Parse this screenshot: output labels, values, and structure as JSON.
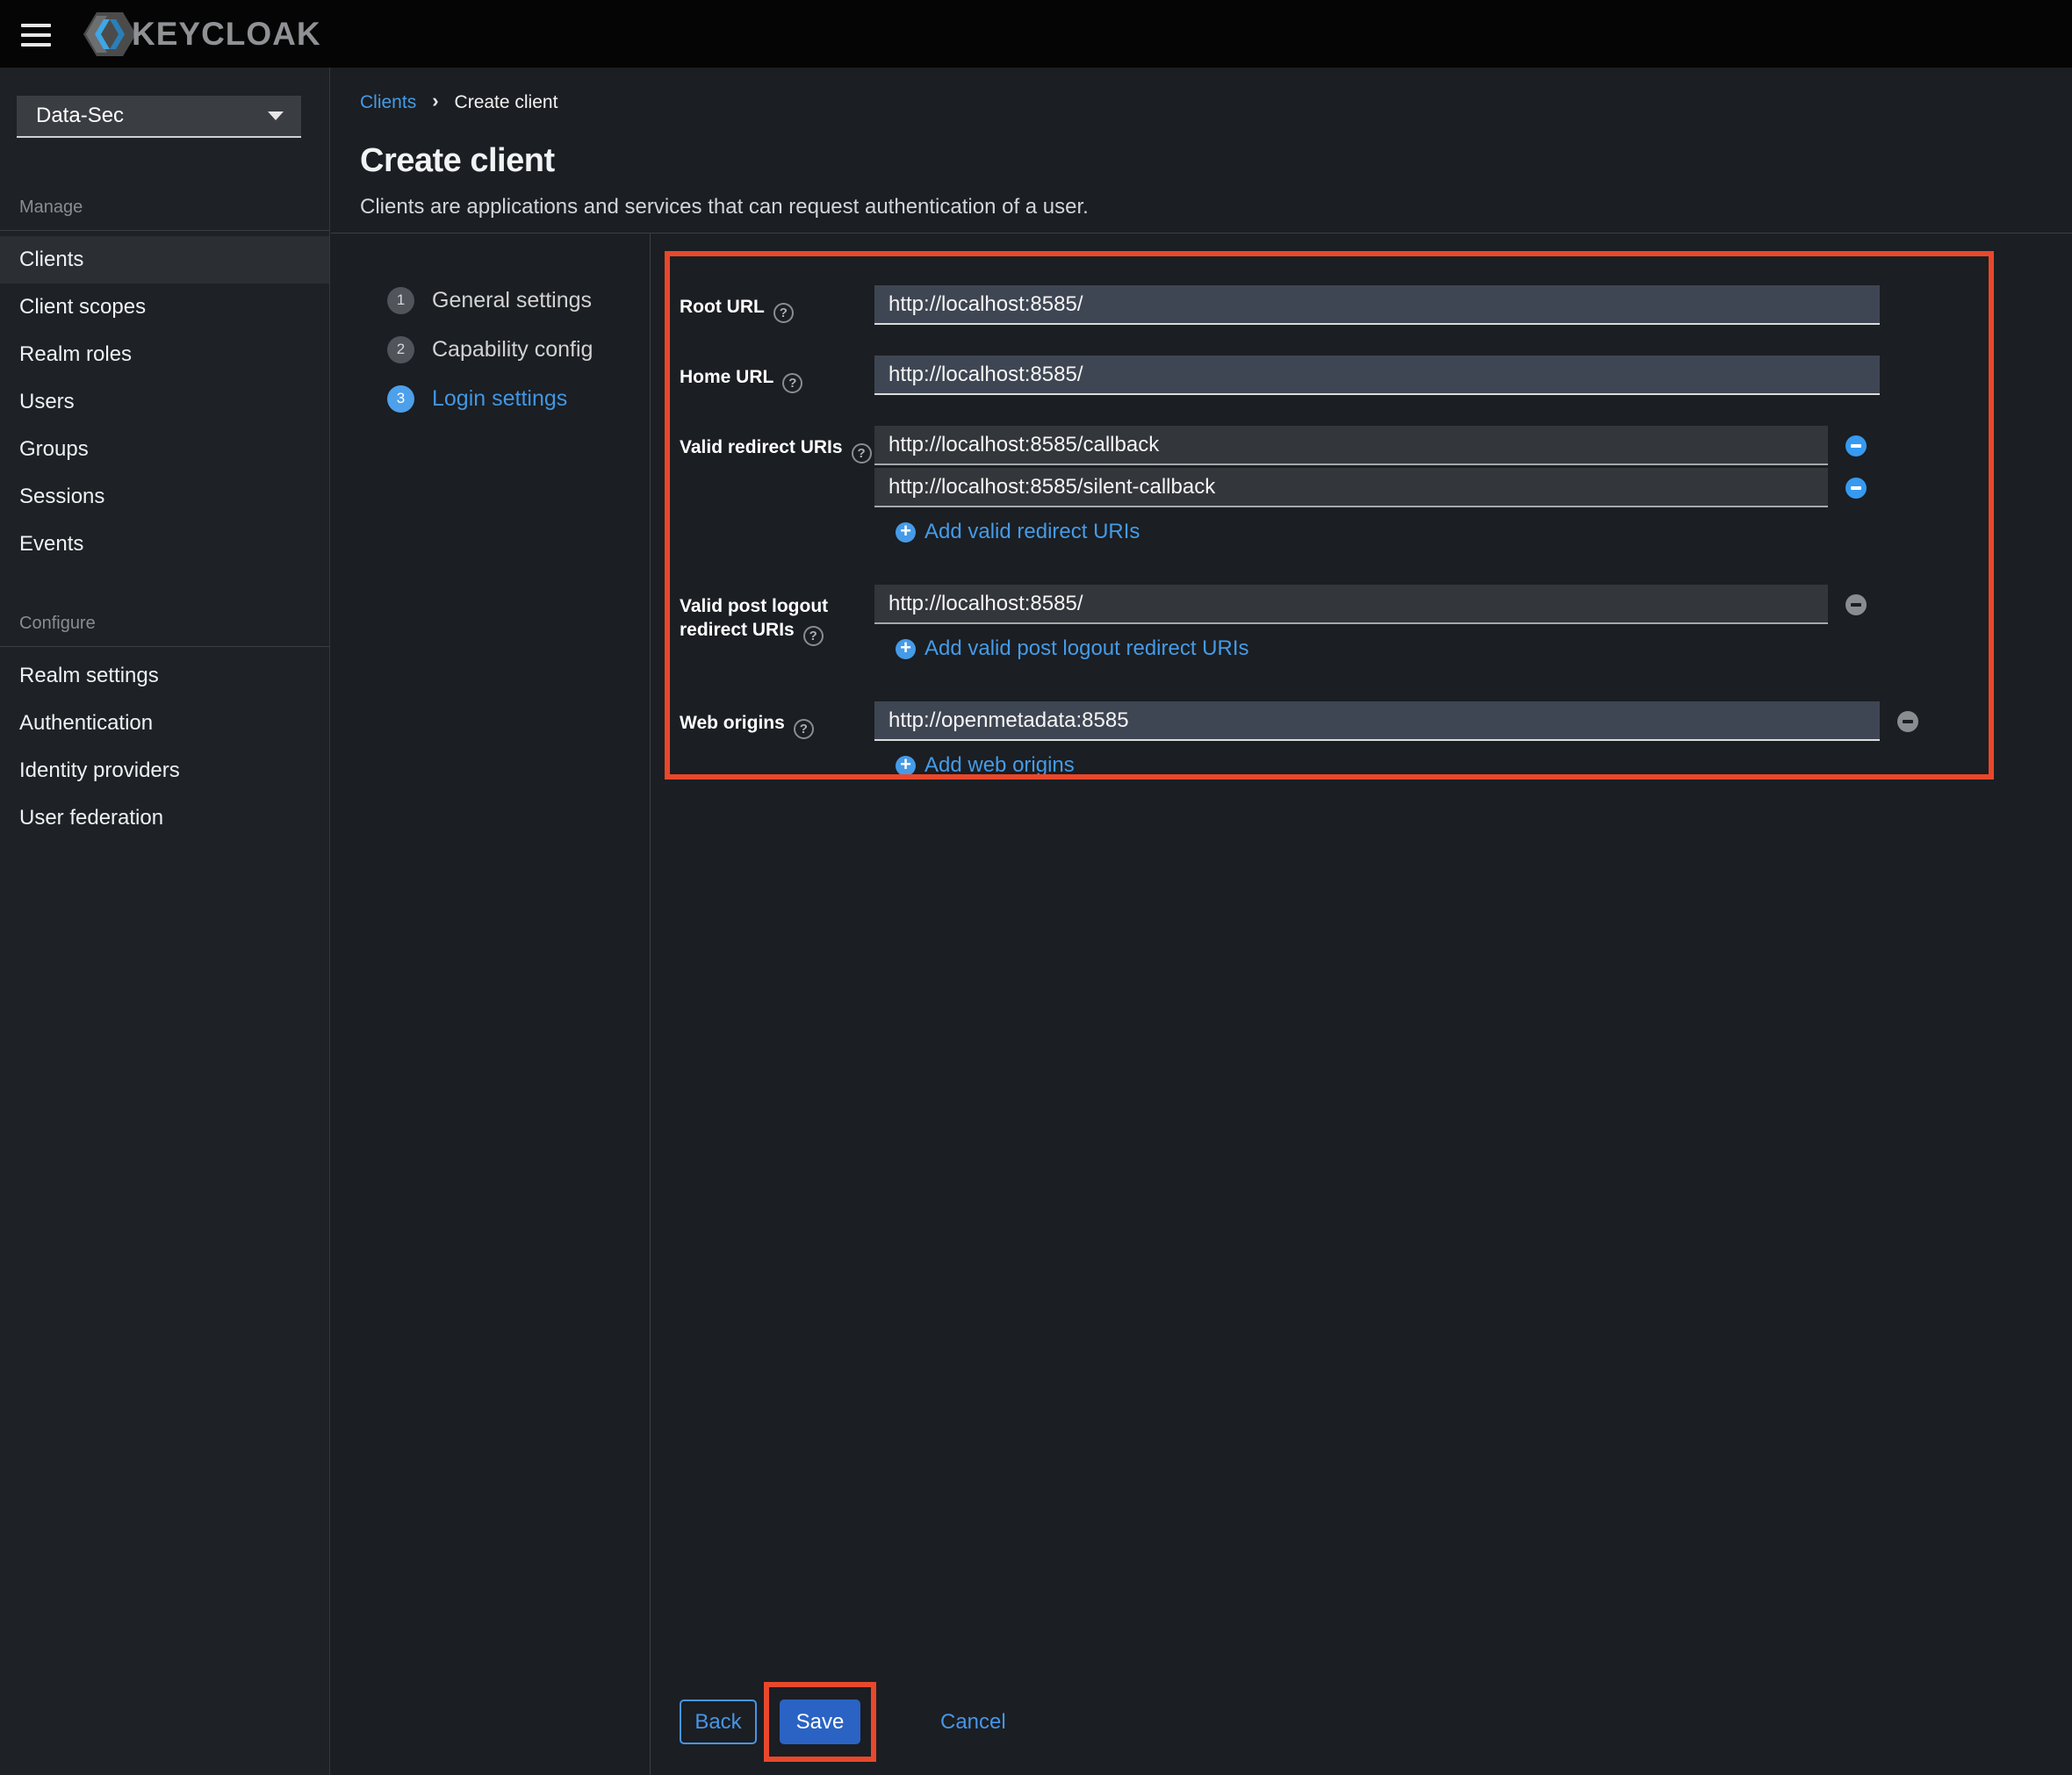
{
  "topbar": {
    "brand": "KEYCLOAK"
  },
  "sidebar": {
    "realm_selector": {
      "value": "Data-Sec"
    },
    "groups": [
      {
        "label": "Manage",
        "items": [
          {
            "label": "Clients",
            "active": true
          },
          {
            "label": "Client scopes"
          },
          {
            "label": "Realm roles"
          },
          {
            "label": "Users"
          },
          {
            "label": "Groups"
          },
          {
            "label": "Sessions"
          },
          {
            "label": "Events"
          }
        ]
      },
      {
        "label": "Configure",
        "items": [
          {
            "label": "Realm settings"
          },
          {
            "label": "Authentication"
          },
          {
            "label": "Identity providers"
          },
          {
            "label": "User federation"
          }
        ]
      }
    ]
  },
  "breadcrumb": {
    "parent": "Clients",
    "current": "Create client"
  },
  "page": {
    "title": "Create client",
    "subtitle": "Clients are applications and services that can request authentication of a user."
  },
  "wizard": {
    "steps": [
      {
        "number": "1",
        "label": "General settings",
        "active": false
      },
      {
        "number": "2",
        "label": "Capability config",
        "active": false
      },
      {
        "number": "3",
        "label": "Login settings",
        "active": true
      }
    ]
  },
  "form": {
    "root_url": {
      "label": "Root URL",
      "value": "http://localhost:8585/"
    },
    "home_url": {
      "label": "Home URL",
      "value": "http://localhost:8585/"
    },
    "redirect_uris": {
      "label": "Valid redirect URIs",
      "values": [
        "http://localhost:8585/callback",
        "http://localhost:8585/silent-callback"
      ],
      "add_label": "Add valid redirect URIs"
    },
    "post_logout_uris": {
      "label_line1": "Valid post logout",
      "label_line2": "redirect URIs",
      "value": "http://localhost:8585/",
      "add_label": "Add valid post logout redirect URIs"
    },
    "web_origins": {
      "label": "Web origins",
      "value": "http://openmetadata:8585",
      "add_label": "Add web origins"
    }
  },
  "footer": {
    "back": "Back",
    "save": "Save",
    "cancel": "Cancel"
  },
  "colors": {
    "annotation_red": "#e8482c",
    "accent_blue": "#459be8",
    "primary_button_blue": "#2a63c4",
    "active_step_blue": "#4da0ea",
    "input_slate": "#3f4653",
    "input_dark": "#33363b",
    "bg_main": "#1b1e22"
  }
}
